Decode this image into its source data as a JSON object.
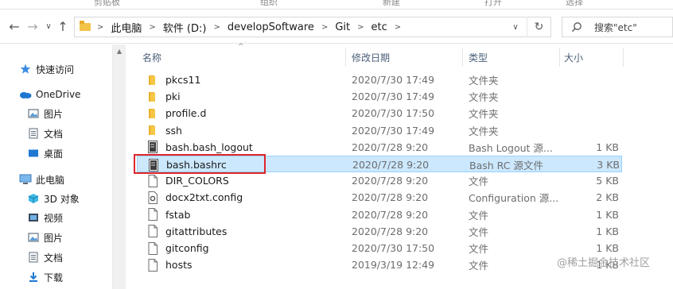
{
  "ribbon": {
    "labels": [
      "剪贴板",
      "组织",
      "新建",
      "打开",
      "选择"
    ]
  },
  "address_bar": {
    "crumbs": [
      "此电脑",
      "软件 (D:)",
      "developSoftware",
      "Git",
      "etc"
    ]
  },
  "search": {
    "placeholder": "搜索\"etc\""
  },
  "nav": {
    "items": [
      {
        "label": "快速访问",
        "icon": "pin-icon"
      },
      {
        "label": "OneDrive",
        "icon": "cloud-icon"
      },
      {
        "label": "图片",
        "icon": "pictures-icon"
      },
      {
        "label": "文档",
        "icon": "documents-icon"
      },
      {
        "label": "桌面",
        "icon": "desktop-icon"
      },
      {
        "label": "此电脑",
        "icon": "computer-icon"
      },
      {
        "label": "3D 对象",
        "icon": "3d-objects-icon"
      },
      {
        "label": "视频",
        "icon": "videos-icon"
      },
      {
        "label": "图片",
        "icon": "pictures-icon"
      },
      {
        "label": "文档",
        "icon": "documents-icon"
      },
      {
        "label": "下载",
        "icon": "downloads-icon"
      }
    ]
  },
  "columns": {
    "name": "名称",
    "date": "修改日期",
    "type": "类型",
    "size": "大小"
  },
  "files": [
    {
      "name": "pkcs11",
      "date": "2020/7/30 17:49",
      "type": "文件夹",
      "size": "",
      "kind": "folder"
    },
    {
      "name": "pki",
      "date": "2020/7/30 17:49",
      "type": "文件夹",
      "size": "",
      "kind": "folder"
    },
    {
      "name": "profile.d",
      "date": "2020/7/30 17:50",
      "type": "文件夹",
      "size": "",
      "kind": "folder"
    },
    {
      "name": "ssh",
      "date": "2020/7/30 17:49",
      "type": "文件夹",
      "size": "",
      "kind": "folder"
    },
    {
      "name": "bash.bash_logout",
      "date": "2020/7/28 9:20",
      "type": "Bash Logout 源...",
      "size": "1 KB",
      "kind": "script"
    },
    {
      "name": "bash.bashrc",
      "date": "2020/7/28 9:20",
      "type": "Bash RC 源文件",
      "size": "3 KB",
      "kind": "script",
      "selected": true
    },
    {
      "name": "DIR_COLORS",
      "date": "2020/7/28 9:20",
      "type": "文件",
      "size": "5 KB",
      "kind": "file"
    },
    {
      "name": "docx2txt.config",
      "date": "2020/7/28 9:20",
      "type": "Configuration 源...",
      "size": "2 KB",
      "kind": "config"
    },
    {
      "name": "fstab",
      "date": "2020/7/28 9:20",
      "type": "文件",
      "size": "1 KB",
      "kind": "file"
    },
    {
      "name": "gitattributes",
      "date": "2020/7/28 9:20",
      "type": "文件",
      "size": "1 KB",
      "kind": "file"
    },
    {
      "name": "gitconfig",
      "date": "2020/7/30 17:50",
      "type": "文件",
      "size": "1 KB",
      "kind": "file"
    },
    {
      "name": "hosts",
      "date": "2019/3/19 12:49",
      "type": "文件",
      "size": "1 KB",
      "kind": "file"
    }
  ],
  "watermark": "@稀土掘金技术社区"
}
